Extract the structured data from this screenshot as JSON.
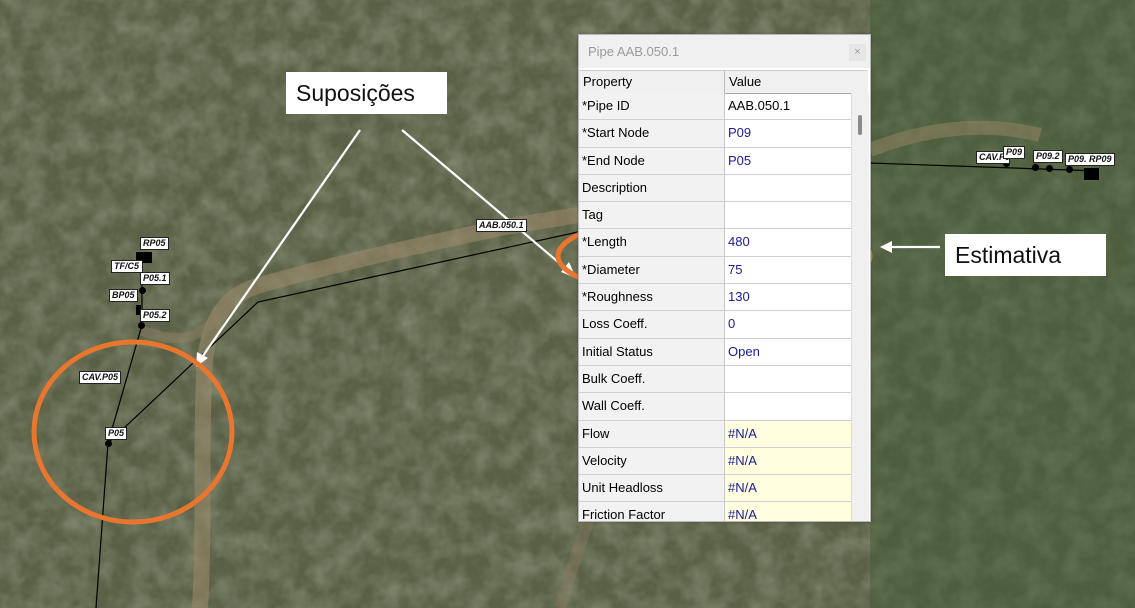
{
  "map": {
    "labels": {
      "rp05": "RP05",
      "tf": "TF/C5",
      "p05_1": "P05.1",
      "bp05": "BP05",
      "p05_2": "P05.2",
      "cav_p05": "CAV.P05",
      "p05": "P05",
      "pipe": "AAB.050.1",
      "cav_p09": "CAV.P09",
      "p09": "P09",
      "p09_2": "P09.2",
      "p09_rp09": "P09. RP09"
    }
  },
  "annotations": {
    "suposicoes": "Suposições",
    "estimativa": "Estimativa",
    "accent_color": "#e8762f"
  },
  "property_window": {
    "title": "Pipe AAB.050.1",
    "close_glyph": "×",
    "col_property": "Property",
    "col_value": "Value",
    "rows": [
      {
        "property": "*Pipe ID",
        "value": "AAB.050.1"
      },
      {
        "property": "*Start Node",
        "value": "P09"
      },
      {
        "property": "*End Node",
        "value": "P05"
      },
      {
        "property": "Description",
        "value": ""
      },
      {
        "property": "Tag",
        "value": ""
      },
      {
        "property": "*Length",
        "value": "480"
      },
      {
        "property": "*Diameter",
        "value": "75"
      },
      {
        "property": "*Roughness",
        "value": "130"
      },
      {
        "property": "Loss Coeff.",
        "value": "0"
      },
      {
        "property": "Initial Status",
        "value": "Open"
      },
      {
        "property": "Bulk Coeff.",
        "value": ""
      },
      {
        "property": "Wall Coeff.",
        "value": ""
      },
      {
        "property": "Flow",
        "value": "#N/A"
      },
      {
        "property": "Velocity",
        "value": "#N/A"
      },
      {
        "property": "Unit Headloss",
        "value": "#N/A"
      },
      {
        "property": "Friction Factor",
        "value": "#N/A"
      }
    ]
  }
}
